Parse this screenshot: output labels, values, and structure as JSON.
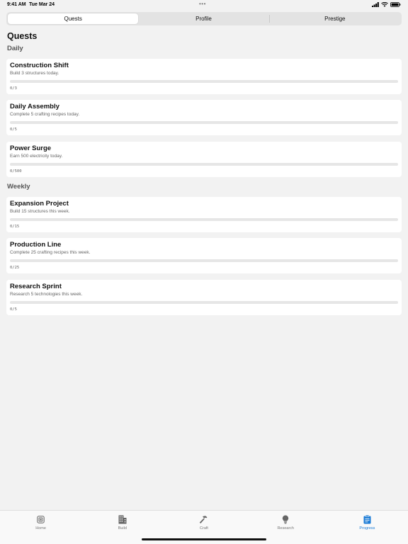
{
  "status_bar": {
    "time": "9:41 AM",
    "date": "Tue Mar 24",
    "dots": "•••",
    "icons": [
      "cellular-icon",
      "wifi-icon",
      "battery-icon"
    ]
  },
  "segments": {
    "items": [
      {
        "label": "Quests",
        "selected": true
      },
      {
        "label": "Profile",
        "selected": false
      },
      {
        "label": "Prestige",
        "selected": false
      }
    ]
  },
  "page": {
    "title": "Quests"
  },
  "sections": {
    "daily": {
      "label": "Daily",
      "quests": [
        {
          "title": "Construction Shift",
          "description": "Build 3 structures today.",
          "progress_text": "0/3",
          "progress": 0
        },
        {
          "title": "Daily Assembly",
          "description": "Complete 5 crafting recipes today.",
          "progress_text": "0/5",
          "progress": 0
        },
        {
          "title": "Power Surge",
          "description": "Earn 500 electricity today.",
          "progress_text": "0/500",
          "progress": 0
        }
      ]
    },
    "weekly": {
      "label": "Weekly",
      "quests": [
        {
          "title": "Expansion Project",
          "description": "Build 15 structures this week.",
          "progress_text": "0/15",
          "progress": 0
        },
        {
          "title": "Production Line",
          "description": "Complete 25 crafting recipes this week.",
          "progress_text": "0/25",
          "progress": 0
        },
        {
          "title": "Research Sprint",
          "description": "Research 5 technologies this week.",
          "progress_text": "0/5",
          "progress": 0
        }
      ]
    }
  },
  "tabbar": {
    "items": [
      {
        "label": "Home",
        "icon": "home-icon",
        "selected": false
      },
      {
        "label": "Build",
        "icon": "building-icon",
        "selected": false
      },
      {
        "label": "Craft",
        "icon": "hammer-icon",
        "selected": false
      },
      {
        "label": "Research",
        "icon": "lightbulb-icon",
        "selected": false
      },
      {
        "label": "Progress",
        "icon": "clipboard-icon",
        "selected": true
      }
    ]
  },
  "colors": {
    "accent": "#1a7bd6",
    "background": "#f2f2f2",
    "card": "#ffffff"
  }
}
